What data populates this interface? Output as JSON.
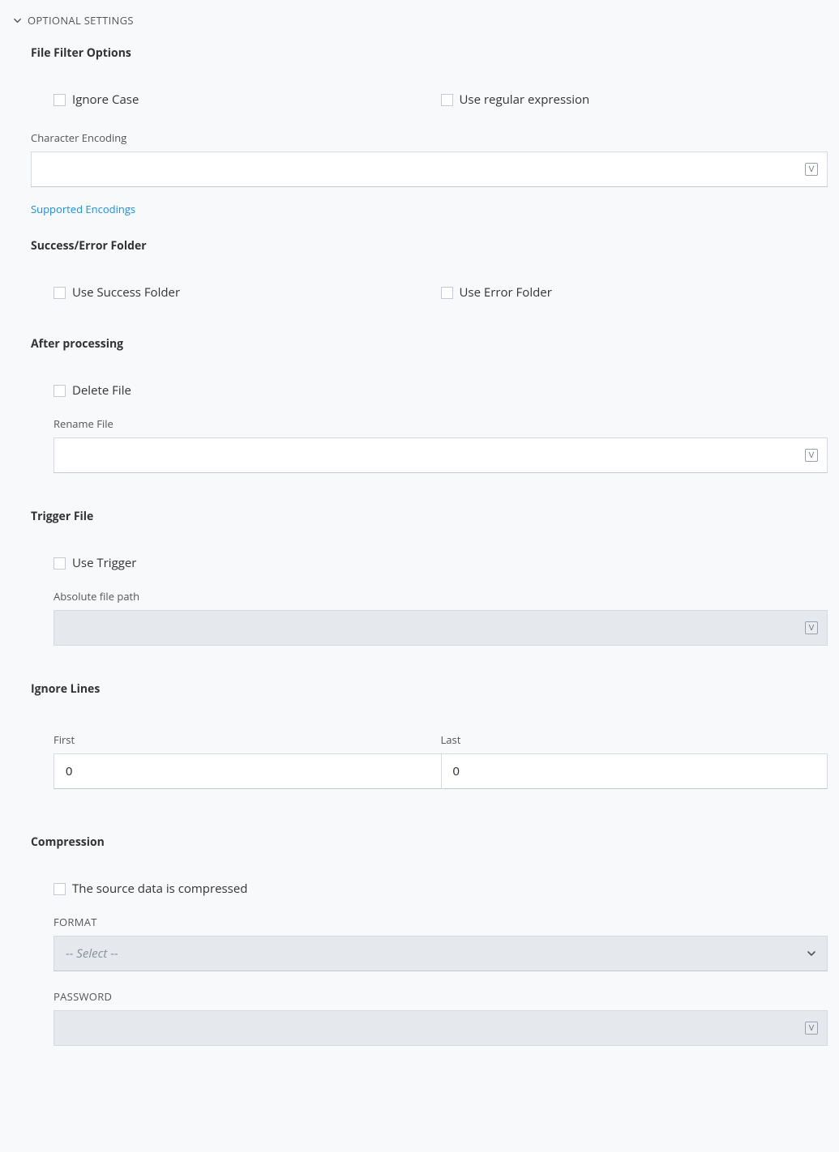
{
  "header": {
    "title": "OPTIONAL SETTINGS"
  },
  "filter": {
    "title": "File Filter Options",
    "ignoreCase": "Ignore Case",
    "useRegex": "Use regular expression",
    "encodingLabel": "Character Encoding",
    "encodingValue": "",
    "supportedLink": "Supported Encodings"
  },
  "folder": {
    "title": "Success/Error Folder",
    "useSuccess": "Use Success Folder",
    "useError": "Use Error Folder"
  },
  "after": {
    "title": "After processing",
    "deleteFile": "Delete File",
    "renameLabel": "Rename File",
    "renameValue": ""
  },
  "trigger": {
    "title": "Trigger File",
    "useTrigger": "Use Trigger",
    "pathLabel": "Absolute file path",
    "pathValue": ""
  },
  "ignore": {
    "title": "Ignore Lines",
    "firstLabel": "First",
    "firstValue": "0",
    "lastLabel": "Last",
    "lastValue": "0"
  },
  "compression": {
    "title": "Compression",
    "isCompressed": "The source data is compressed",
    "formatLabel": "FORMAT",
    "formatPlaceholder": "-- Select --",
    "passwordLabel": "PASSWORD",
    "passwordValue": ""
  },
  "glyph": {
    "v": "V"
  }
}
